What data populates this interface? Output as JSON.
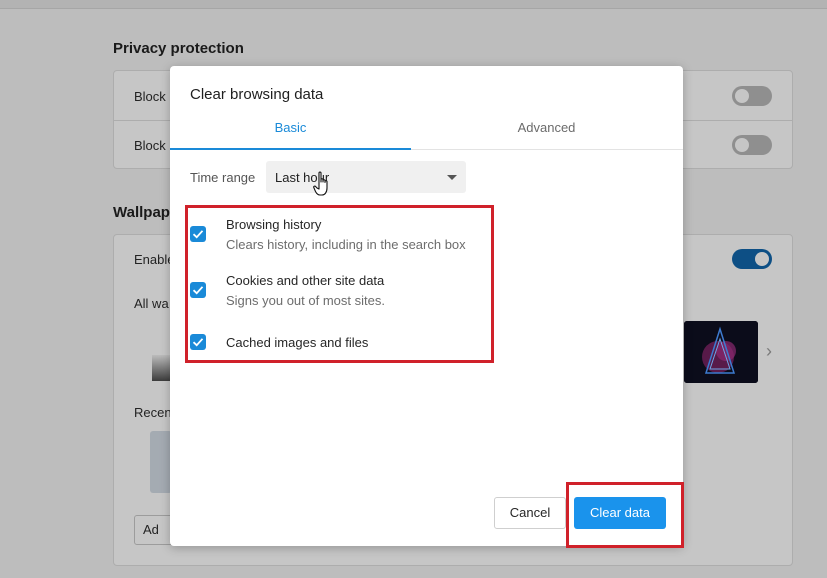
{
  "background": {
    "privacy_heading": "Privacy protection",
    "block_row_1": "Block",
    "block_row_2": "Block",
    "wallpaper_heading": "Wallpap",
    "enable_row": "Enable",
    "all_wallpapers_row": "All wa",
    "recent_row": "Recen",
    "add_button": "Ad",
    "chevron": "›"
  },
  "dialog": {
    "title": "Clear browsing data",
    "tabs": [
      {
        "label": "Basic",
        "active": true
      },
      {
        "label": "Advanced",
        "active": false
      }
    ],
    "time_range_label": "Time range",
    "time_range_value": "Last hour",
    "items": [
      {
        "title": "Browsing history",
        "subtitle": "Clears history, including in the search box",
        "checked": true
      },
      {
        "title": "Cookies and other site data",
        "subtitle": "Signs you out of most sites.",
        "checked": true
      },
      {
        "title": "Cached images and files",
        "subtitle": "",
        "checked": true
      }
    ],
    "cancel_label": "Cancel",
    "clear_label": "Clear data"
  },
  "colors": {
    "accent": "#1a8ad8",
    "primary_button": "#1a93ec",
    "highlight_box": "#d0212a"
  },
  "icons": {
    "cursor": "hand-pointer-icon",
    "check": "checkmark-icon",
    "dropdown": "chevron-down-icon"
  }
}
